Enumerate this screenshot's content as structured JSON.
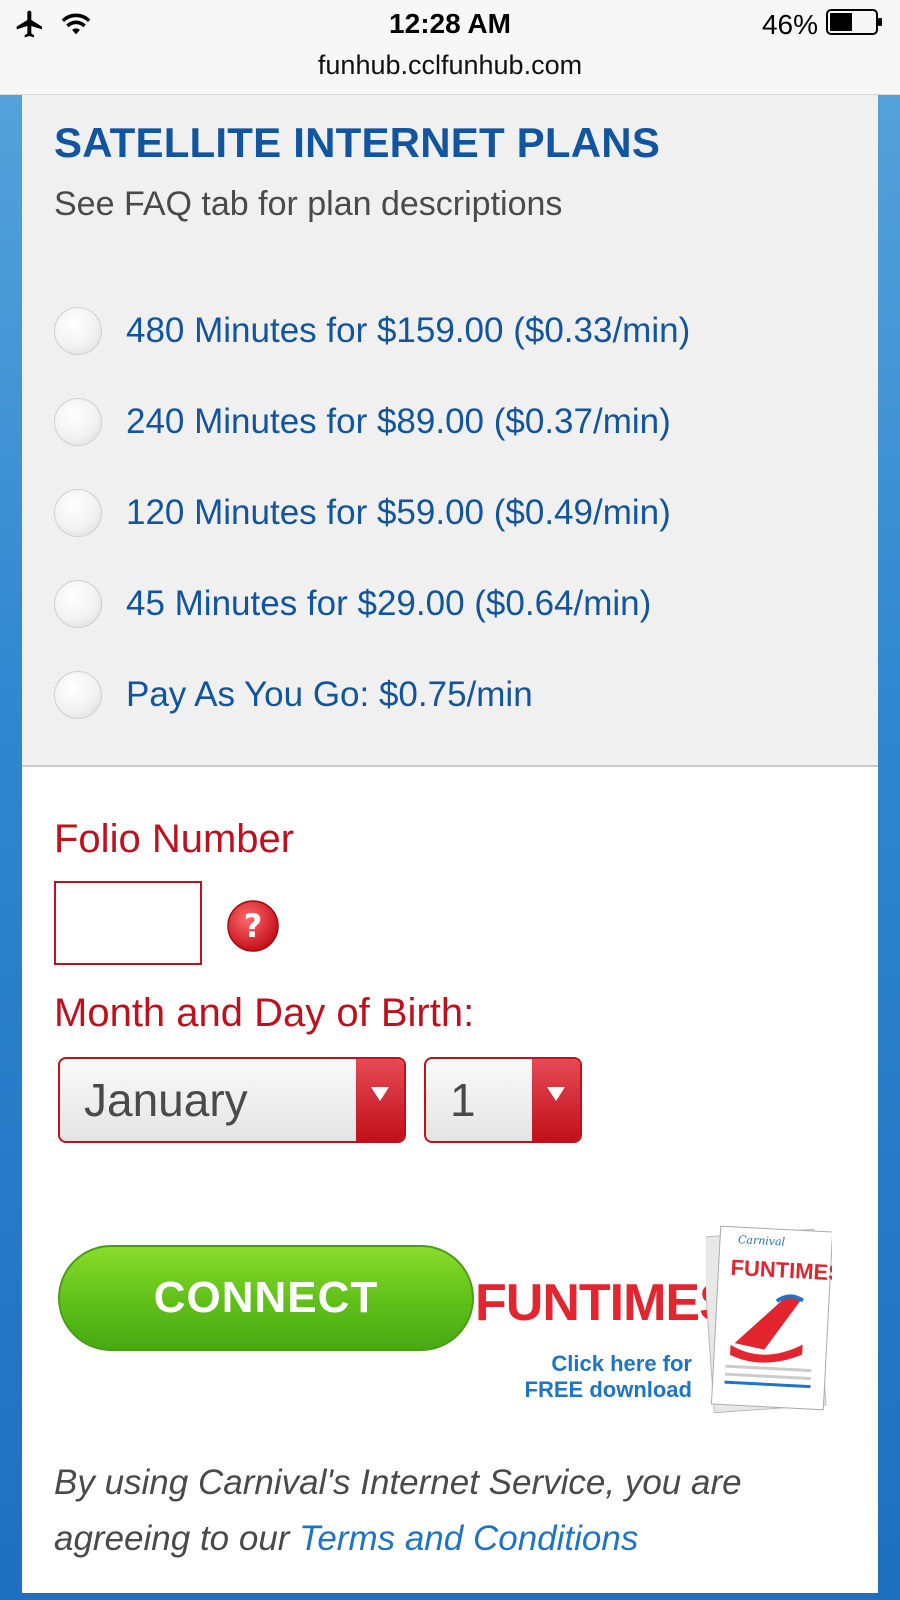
{
  "status_bar": {
    "time": "12:28 AM",
    "battery": "46%",
    "url": "funhub.cclfunhub.com"
  },
  "plans": {
    "title": "SATELLITE INTERNET PLANS",
    "subtitle": "See FAQ tab for plan descriptions",
    "items": [
      {
        "label": "480 Minutes for $159.00 ($0.33/min)"
      },
      {
        "label": "240 Minutes for $89.00 ($0.37/min)"
      },
      {
        "label": "120 Minutes for $59.00 ($0.49/min)"
      },
      {
        "label": "45 Minutes for $29.00 ($0.64/min)"
      },
      {
        "label": "Pay As You Go: $0.75/min"
      }
    ]
  },
  "form": {
    "folio_label": "Folio Number",
    "folio_value": "",
    "dob_label": "Month and Day of Birth:",
    "month_value": "January",
    "day_value": "1"
  },
  "connect": {
    "label": "CONNECT"
  },
  "funtimes": {
    "title": "FUNTIMES",
    "cta_line1": "Click here for",
    "cta_line2": "FREE download",
    "paper_brand": "Carnival",
    "paper_title": "FUNTIMES"
  },
  "footer": {
    "text": "By using Carnival's Internet Service, you are agreeing to our ",
    "link": "Terms and Conditions"
  },
  "colors": {
    "primary_blue": "#1155a0",
    "link_blue": "#1e74c7",
    "accent_red": "#c0101c",
    "connect_green": "#62c21a"
  }
}
